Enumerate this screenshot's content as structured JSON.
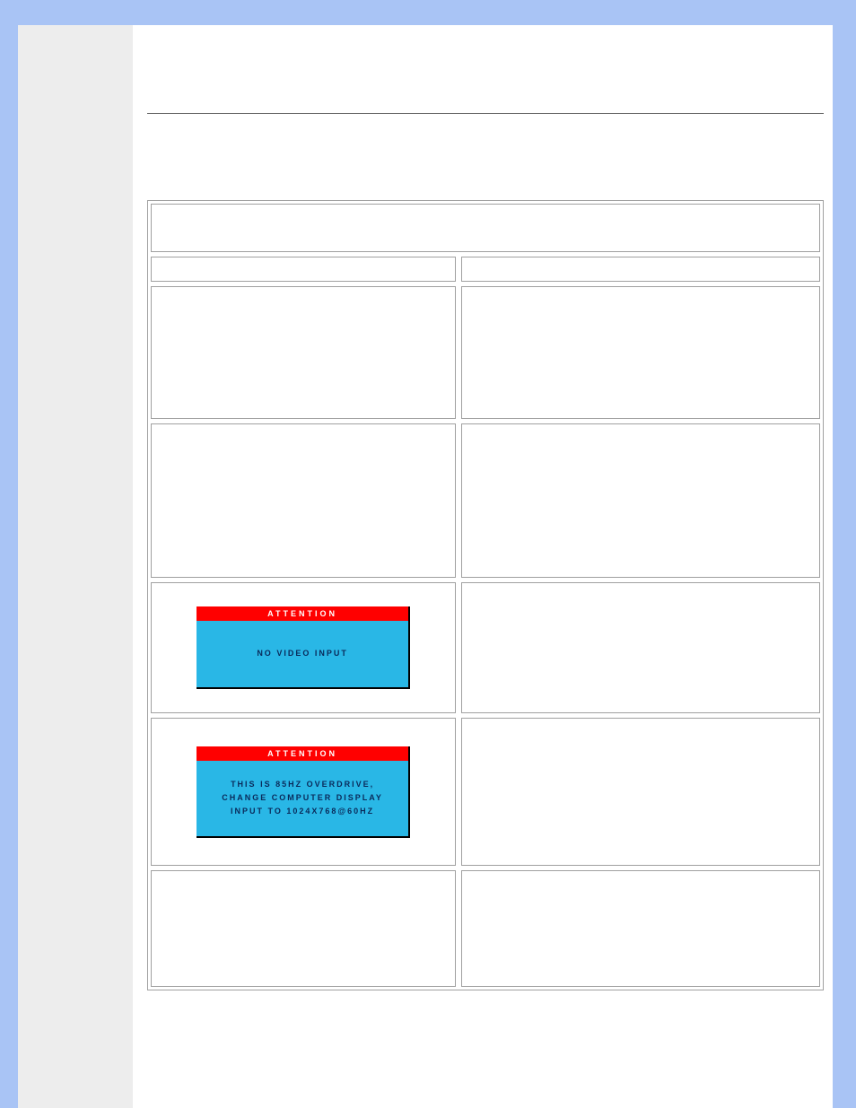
{
  "title_area": "",
  "prelude": "",
  "table": {
    "header_full": "",
    "subheader_left": "",
    "subheader_right": "",
    "rows": [
      {
        "left": "",
        "right": ""
      },
      {
        "left": "",
        "right": ""
      },
      {
        "left": "",
        "right": ""
      },
      {
        "left": "",
        "right": ""
      },
      {
        "left": "",
        "right": ""
      }
    ]
  },
  "messages": {
    "box1": {
      "bar": "ATTENTION",
      "lines": [
        "NO VIDEO INPUT"
      ]
    },
    "box2": {
      "bar": "ATTENTION",
      "lines": [
        "THIS IS 85HZ OVERDRIVE,",
        "CHANGE COMPUTER DISPLAY",
        "INPUT TO 1024X768@60HZ"
      ]
    }
  }
}
